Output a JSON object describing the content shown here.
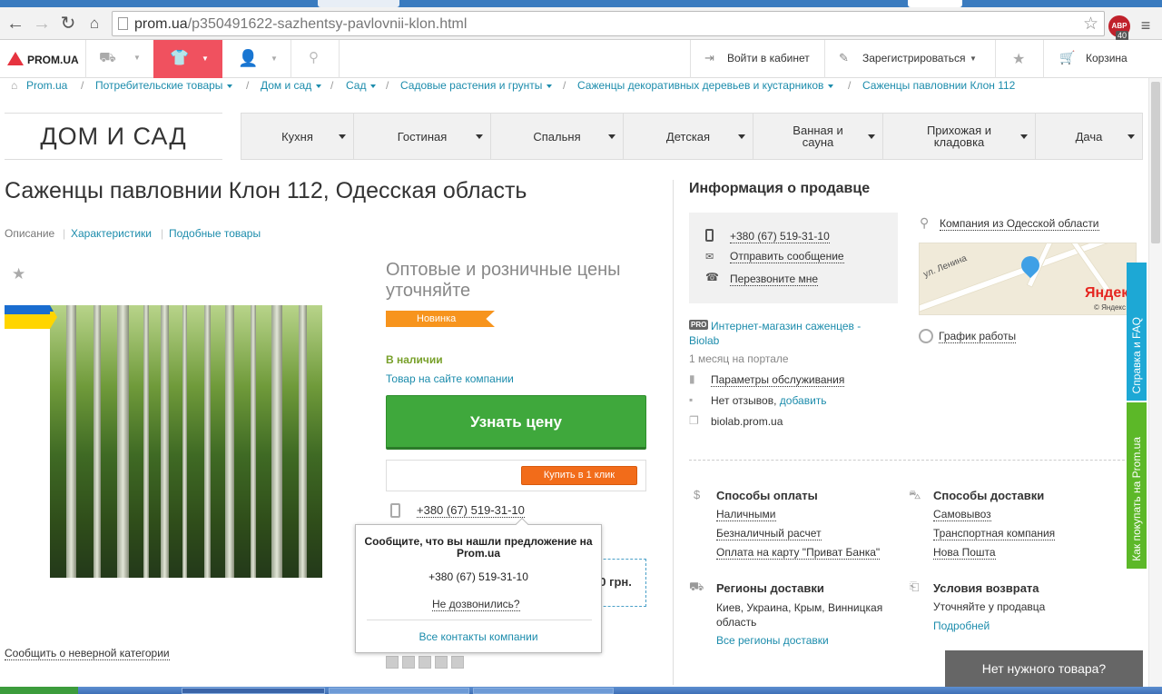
{
  "browser": {
    "url_host": "prom.ua",
    "url_path": "/p350491622-sazhentsy-pavlovnii-klon.html",
    "abp_label": "ABP",
    "abp_count": "40"
  },
  "topbar": {
    "logo": "PROM.UA",
    "login": "Войти в кабинет",
    "register": "Зарегистрироваться",
    "cart": "Корзина"
  },
  "breadcrumbs": [
    "Prom.ua",
    "Потребительские товары",
    "Дом и сад",
    "Сад",
    "Садовые растения и грунты",
    "Саженцы декоративных деревьев и кустарников",
    "Саженцы павловнии Клон 112"
  ],
  "category": {
    "title": "ДОМ И САД",
    "nav": [
      "Кухня",
      "Гостиная",
      "Спальня",
      "Детская",
      "Ванная и сауна",
      "Прихожая и кладовка",
      "Дача"
    ]
  },
  "product": {
    "title": "Саженцы павловнии Клон 112, Одесская область",
    "tabs": [
      "Описание",
      "Характеристики",
      "Подобные товары"
    ],
    "price_note": "Оптовые и розничные цены уточняйте",
    "badge": "Новинка",
    "stock": "В наличии",
    "on_site": "Товар на сайте компании",
    "ask_price": "Узнать цену",
    "buy_one_click": "Купить в 1 клик",
    "phone": "+380 (67) 519-31-10",
    "price_fragment": "00 грн.",
    "report_category": "Сообщить о неверной категории"
  },
  "popup": {
    "heading": "Сообщите, что вы нашли предложение на Prom.ua",
    "phone": "+380 (67) 519-31-10",
    "not_reached": "Не дозвонились?",
    "all_contacts": "Все контакты компании"
  },
  "seller": {
    "heading": "Информация о продавце",
    "phone": "+380 (67) 519-31-10",
    "send_message": "Отправить сообщение",
    "callback": "Перезвоните мне",
    "region": "Компания из Одесской области",
    "map_street": "ул. Ленина",
    "map_brand": "Яндекс",
    "map_copy": "© Яндекс",
    "schedule": "График работы",
    "pro": "PRO",
    "shop_name": "Интернет-магазин саженцев - Biolab",
    "age": "1 месяц на портале",
    "service_params": "Параметры обслуживания",
    "reviews": "Нет отзывов,",
    "add_review": "добавить",
    "site": "biolab.prom.ua"
  },
  "payment": {
    "heading": "Способы оплаты",
    "items": [
      "Наличными",
      "Безналичный расчет",
      "Оплата на карту \"Приват Банка\""
    ]
  },
  "delivery": {
    "heading": "Способы доставки",
    "items": [
      "Самовывоз",
      "Транспортная компания",
      "Нова Пошта"
    ]
  },
  "regions": {
    "heading": "Регионы доставки",
    "text": "Киев, Украина, Крым, Винницкая область",
    "all": "Все регионы доставки"
  },
  "returns": {
    "heading": "Условия возврата",
    "text": "Уточняйте у продавца",
    "more": "Подробней"
  },
  "side": {
    "faq": "Справка и FAQ",
    "how_to_buy": "Как покупать на Prom.ua",
    "no_item": "Нет нужного товара?"
  },
  "colors": {
    "accent_red": "#f0515f",
    "link": "#1c8cac",
    "green_button": "#3fa83c",
    "orange": "#f26c1a",
    "badge": "#f7941d"
  }
}
